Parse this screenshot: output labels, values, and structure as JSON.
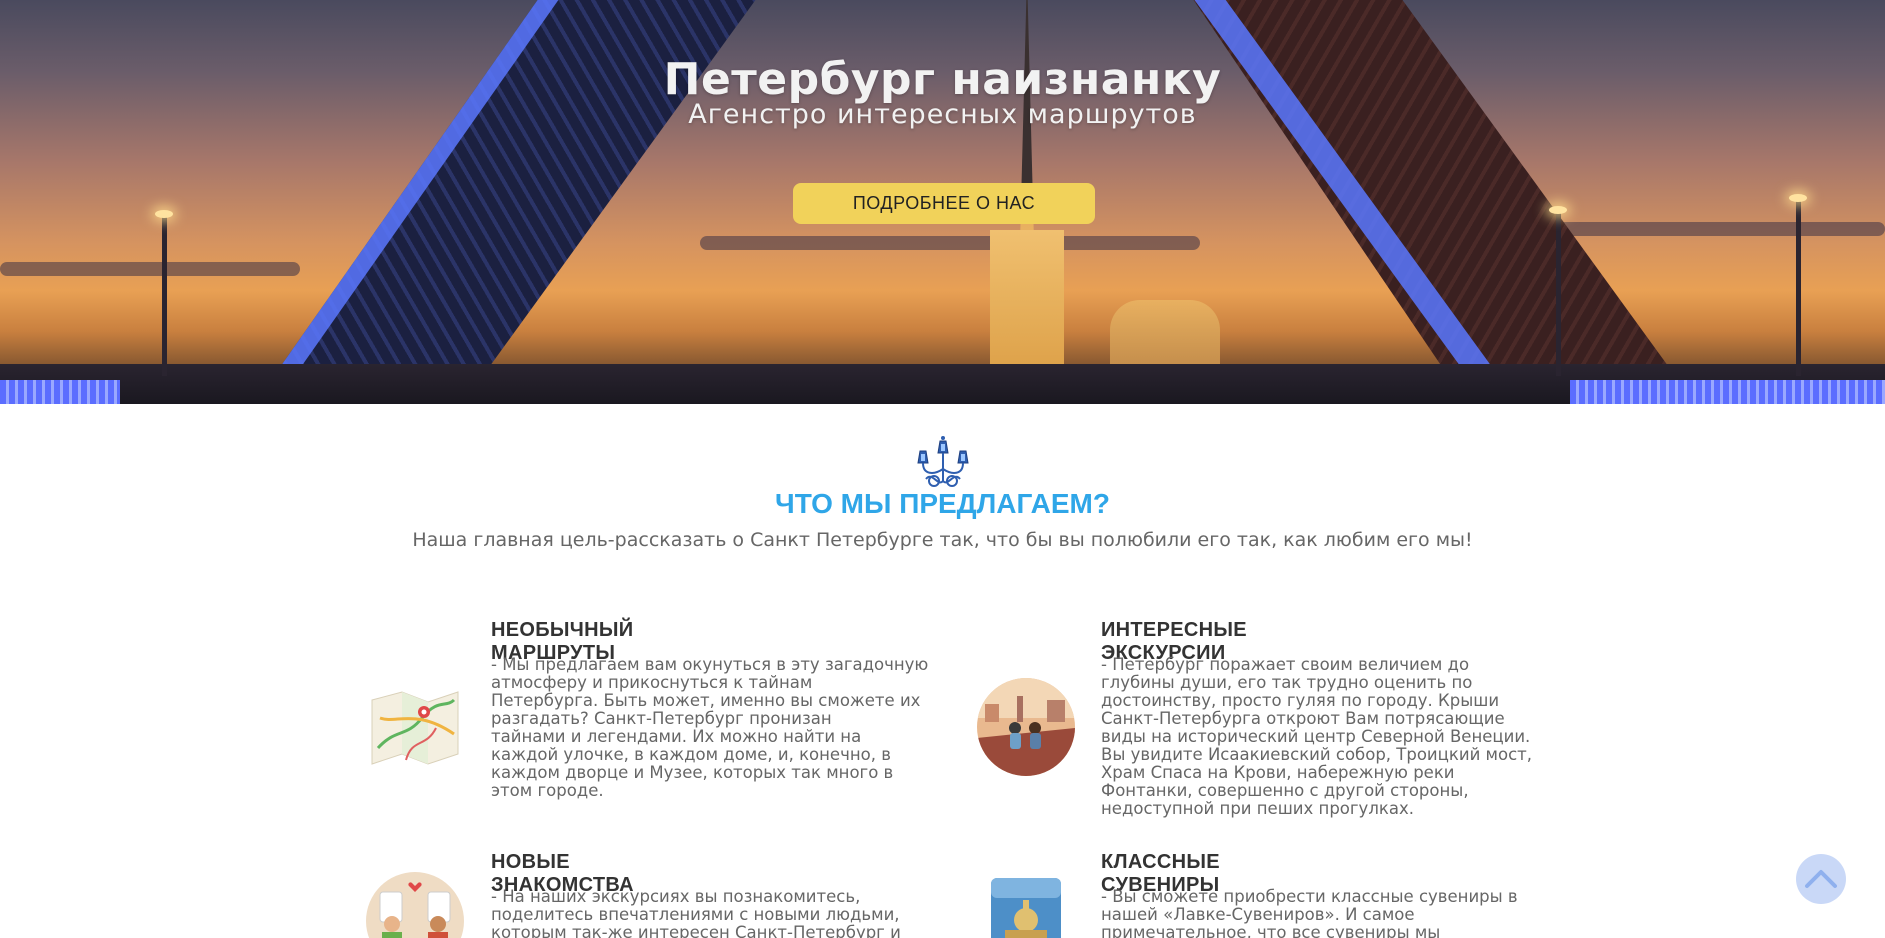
{
  "hero": {
    "title": "Петербург наизнанку",
    "subtitle": "Агенстро интересных маршрутов",
    "button_label": "ПОДРОБНЕЕ О НАС"
  },
  "offer": {
    "title": "ЧТО МЫ ПРЕДЛАГАЕМ?",
    "subtitle": "Наша главная цель-рассказать о Санкт Петербурге так, что бы вы полюбили его так, как любим его мы!",
    "cards": [
      {
        "icon": "map-icon",
        "title": "НЕОБЫЧНЫЙ МАРШРУТЫ",
        "lines": [
          "- Мы предлагаем вам окунуться в эту загадочную",
          "атмосферу и прикоснуться к тайнам",
          "Петербурга. Быть может, именно вы сможете их",
          "разгадать? Санкт-Петербург пронизан",
          "тайнами и легендами. Их можно найти на",
          "каждой улочке, в каждом доме, и, конечно, в",
          "каждом дворце и Музее, которых так много в",
          "этом городе."
        ]
      },
      {
        "icon": "rooftop-icon",
        "title": "ИНТЕРЕСНЫЕ ЭКСКУРСИИ",
        "lines": [
          "- Петербург поражает своим величием до",
          "глубины души, его так трудно оценить по",
          "достоинству, просто гуляя по городу. Крыши",
          "Санкт-Петербурга откроют Вам потрясающие",
          "виды на исторический центр Северной Венеции.",
          "Вы увидите Исаакиевский собор, Троицкий мост,",
          "Храм Спаса на Крови, набережную реки",
          "Фонтанки, совершенно с другой стороны,",
          "недоступной при пеших прогулках."
        ]
      },
      {
        "icon": "people-chat-icon",
        "title": "НОВЫЕ ЗНАКОМСТВА",
        "lines": [
          "- На наших экскурсиях вы познакомитесь,",
          "поделитесь впечатлениями с новыми людьми,",
          "которым так-же интересен Санкт-Петербург и"
        ]
      },
      {
        "icon": "souvenir-mug-icon",
        "title": "КЛАССНЫЕ СУВЕНИРЫ",
        "lines": [
          "- Вы сможете приобрести классные сувениры в",
          "нашей «Лавке-Сувениров». И самое",
          "примечательное, что все сувениры мы"
        ]
      }
    ]
  },
  "scroll_top": {
    "icon": "chevron-up-icon"
  }
}
